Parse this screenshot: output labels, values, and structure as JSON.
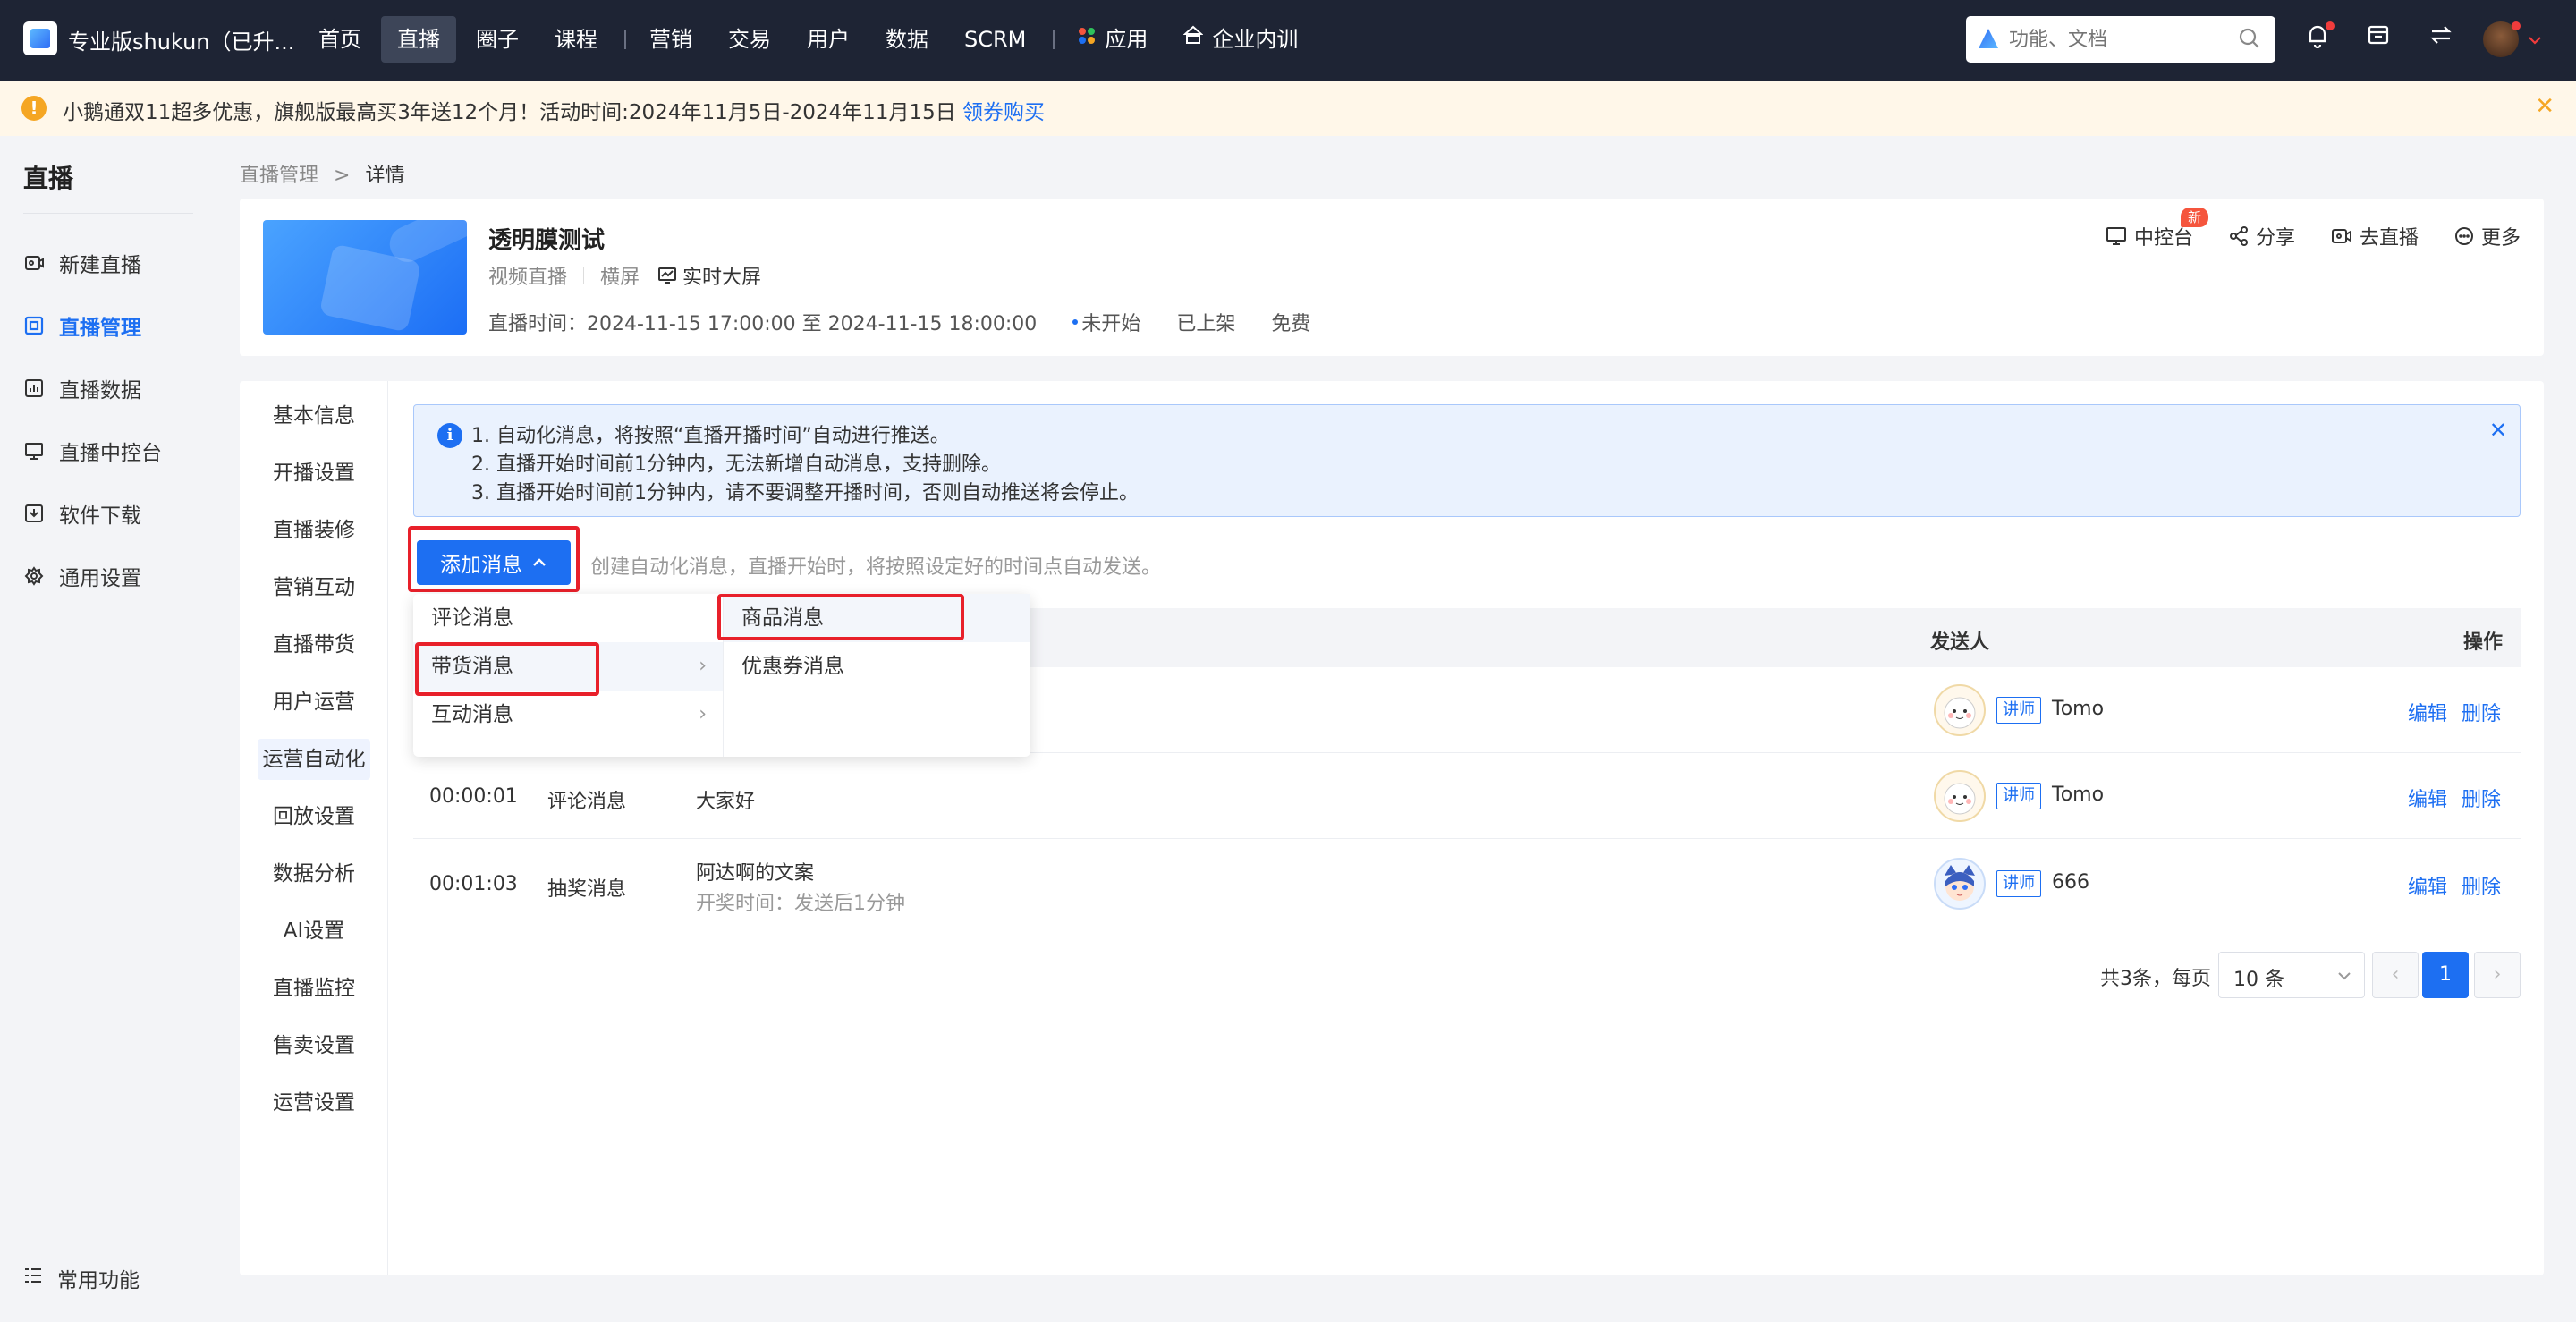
{
  "topbar": {
    "brand": "专业版shukun（已升...",
    "nav": [
      "首页",
      "直播",
      "圈子",
      "课程",
      "营销",
      "交易",
      "用户",
      "数据",
      "SCRM",
      "应用",
      "企业内训"
    ],
    "search_placeholder": "功能、文档"
  },
  "notice": {
    "text": "小鹅通双11超多优惠，旗舰版最高买3年送12个月！活动时间:2024年11月5日-2024年11月15日",
    "link": "领券购买"
  },
  "sidebar": {
    "title": "直播",
    "items": [
      "新建直播",
      "直播管理",
      "直播数据",
      "直播中控台",
      "软件下载",
      "通用设置"
    ],
    "bottom": "常用功能"
  },
  "breadcrumb": {
    "parent": "直播管理",
    "sep": ">",
    "current": "详情"
  },
  "live": {
    "title": "透明膜测试",
    "type": "视频直播",
    "orientation": "横屏",
    "screen": "实时大屏",
    "time_label": "直播时间：2024-11-15 17:00:00 至 2024-11-15 18:00:00",
    "status": "未开始",
    "shelf": "已上架",
    "price": "免费",
    "actions": [
      "中控台",
      "分享",
      "去直播",
      "更多"
    ],
    "new_badge": "新"
  },
  "submenu": [
    "基本信息",
    "开播设置",
    "直播装修",
    "营销互动",
    "直播带货",
    "用户运营",
    "运营自动化",
    "回放设置",
    "数据分析",
    "AI设置",
    "直播监控",
    "售卖设置",
    "运营设置"
  ],
  "tip": [
    "1. 自动化消息，将按照“直播开播时间”自动进行推送。",
    "2. 直播开始时间前1分钟内，无法新增自动消息，支持删除。",
    "3. 直播开始时间前1分钟内，请不要调整开播时间，否则自动推送将会停止。"
  ],
  "add_button": "添加消息",
  "hint": "创建自动化消息，直播开始时，将按照设定好的时间点自动发送。",
  "table": {
    "headers": {
      "sender": "发送人",
      "ops": "操作"
    },
    "rows": [
      {
        "time": "",
        "type": "",
        "content": "",
        "sub": "",
        "tag": "讲师",
        "sender": "Tomo",
        "edit": "编辑",
        "del": "删除"
      },
      {
        "time": "00:00:01",
        "type": "评论消息",
        "content": "大家好",
        "sub": "",
        "tag": "讲师",
        "sender": "Tomo",
        "edit": "编辑",
        "del": "删除"
      },
      {
        "time": "00:01:03",
        "type": "抽奖消息",
        "content": "阿达啊的文案",
        "sub": "开奖时间：发送后1分钟",
        "tag": "讲师",
        "sender": "666",
        "edit": "编辑",
        "del": "删除"
      }
    ]
  },
  "pagination": {
    "total": "共3条，每页",
    "size": "10 条",
    "page": "1"
  },
  "dropdown": {
    "left": [
      "评论消息",
      "带货消息",
      "互动消息"
    ],
    "right": [
      "商品消息",
      "优惠券消息"
    ]
  },
  "colors": {
    "primary": "#1d6ff2",
    "topbar": "#1e2434",
    "highlight": "#e8202a"
  }
}
